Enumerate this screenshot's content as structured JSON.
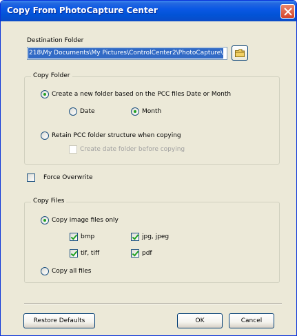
{
  "window": {
    "title": "Copy From PhotoCapture Center"
  },
  "destination": {
    "label": "Destination Folder",
    "path": "218\\My Documents\\My Pictures\\ControlCenter2\\PhotoCapture\\",
    "browse_icon": "folder-icon"
  },
  "copy_folder": {
    "group_title": "Copy Folder",
    "create_new_label": "Create a new folder based on the PCC files Date or Month",
    "date_label": "Date",
    "month_label": "Month",
    "retain_label": "Retain PCC folder structure when copying",
    "create_date_label": "Create date folder before copying"
  },
  "force_overwrite_label": "Force Overwrite",
  "copy_files": {
    "group_title": "Copy Files",
    "image_only_label": "Copy image files only",
    "bmp_label": "bmp",
    "jpg_label": "jpg, jpeg",
    "tif_label": "tif, tiff",
    "pdf_label": "pdf",
    "all_files_label": "Copy all files"
  },
  "buttons": {
    "restore_label": "Restore Defaults",
    "ok_label": "OK",
    "cancel_label": "Cancel"
  },
  "colors": {
    "titlebar": "#0a58e4",
    "close": "#d5452b",
    "selection": "#316ac5",
    "check": "#21a121"
  }
}
